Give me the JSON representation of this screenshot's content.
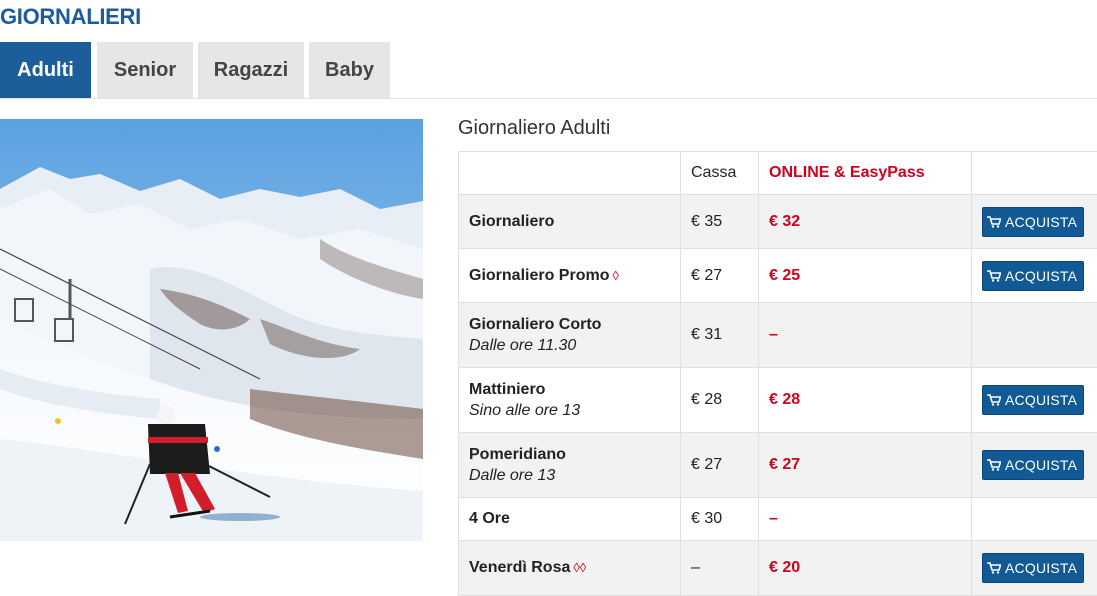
{
  "section_title": "GIORNALIERI",
  "tabs": [
    {
      "label": "Adulti",
      "active": true
    },
    {
      "label": "Senior",
      "active": false
    },
    {
      "label": "Ragazzi",
      "active": false
    },
    {
      "label": "Baby",
      "active": false
    }
  ],
  "table": {
    "title": "Giornaliero Adulti",
    "headers": {
      "name": "",
      "cassa": "Cassa",
      "online": "ONLINE & EasyPass",
      "action": ""
    },
    "buy_label": "ACQUISTA",
    "rows": [
      {
        "name": "Giornaliero",
        "note": "",
        "diamonds": "",
        "cassa": "€ 35",
        "online": "€ 32",
        "buy": true
      },
      {
        "name": "Giornaliero Promo",
        "note": "",
        "diamonds": "◊",
        "cassa": "€ 27",
        "online": "€ 25",
        "buy": true
      },
      {
        "name": "Giornaliero Corto",
        "note": "Dalle ore 11.30",
        "diamonds": "",
        "cassa": "€ 31",
        "online": "–",
        "buy": false
      },
      {
        "name": "Mattiniero",
        "note": "Sino alle ore 13",
        "diamonds": "",
        "cassa": "€ 28",
        "online": "€ 28",
        "buy": true
      },
      {
        "name": "Pomeridiano",
        "note": "Dalle ore 13",
        "diamonds": "",
        "cassa": "€ 27",
        "online": "€ 27",
        "buy": true
      },
      {
        "name": "4 Ore",
        "note": "",
        "diamonds": "",
        "cassa": "€ 30",
        "online": "–",
        "buy": false
      },
      {
        "name": "Venerdì Rosa",
        "note": "",
        "diamonds": "◊◊",
        "cassa": "–",
        "online": "€ 20",
        "buy": true
      }
    ]
  },
  "colors": {
    "brand_blue": "#1b5e9a",
    "online_red": "#d0021b",
    "tab_inactive": "#e6e6e6"
  },
  "icons": {
    "buy": "shopping-cart-icon"
  }
}
